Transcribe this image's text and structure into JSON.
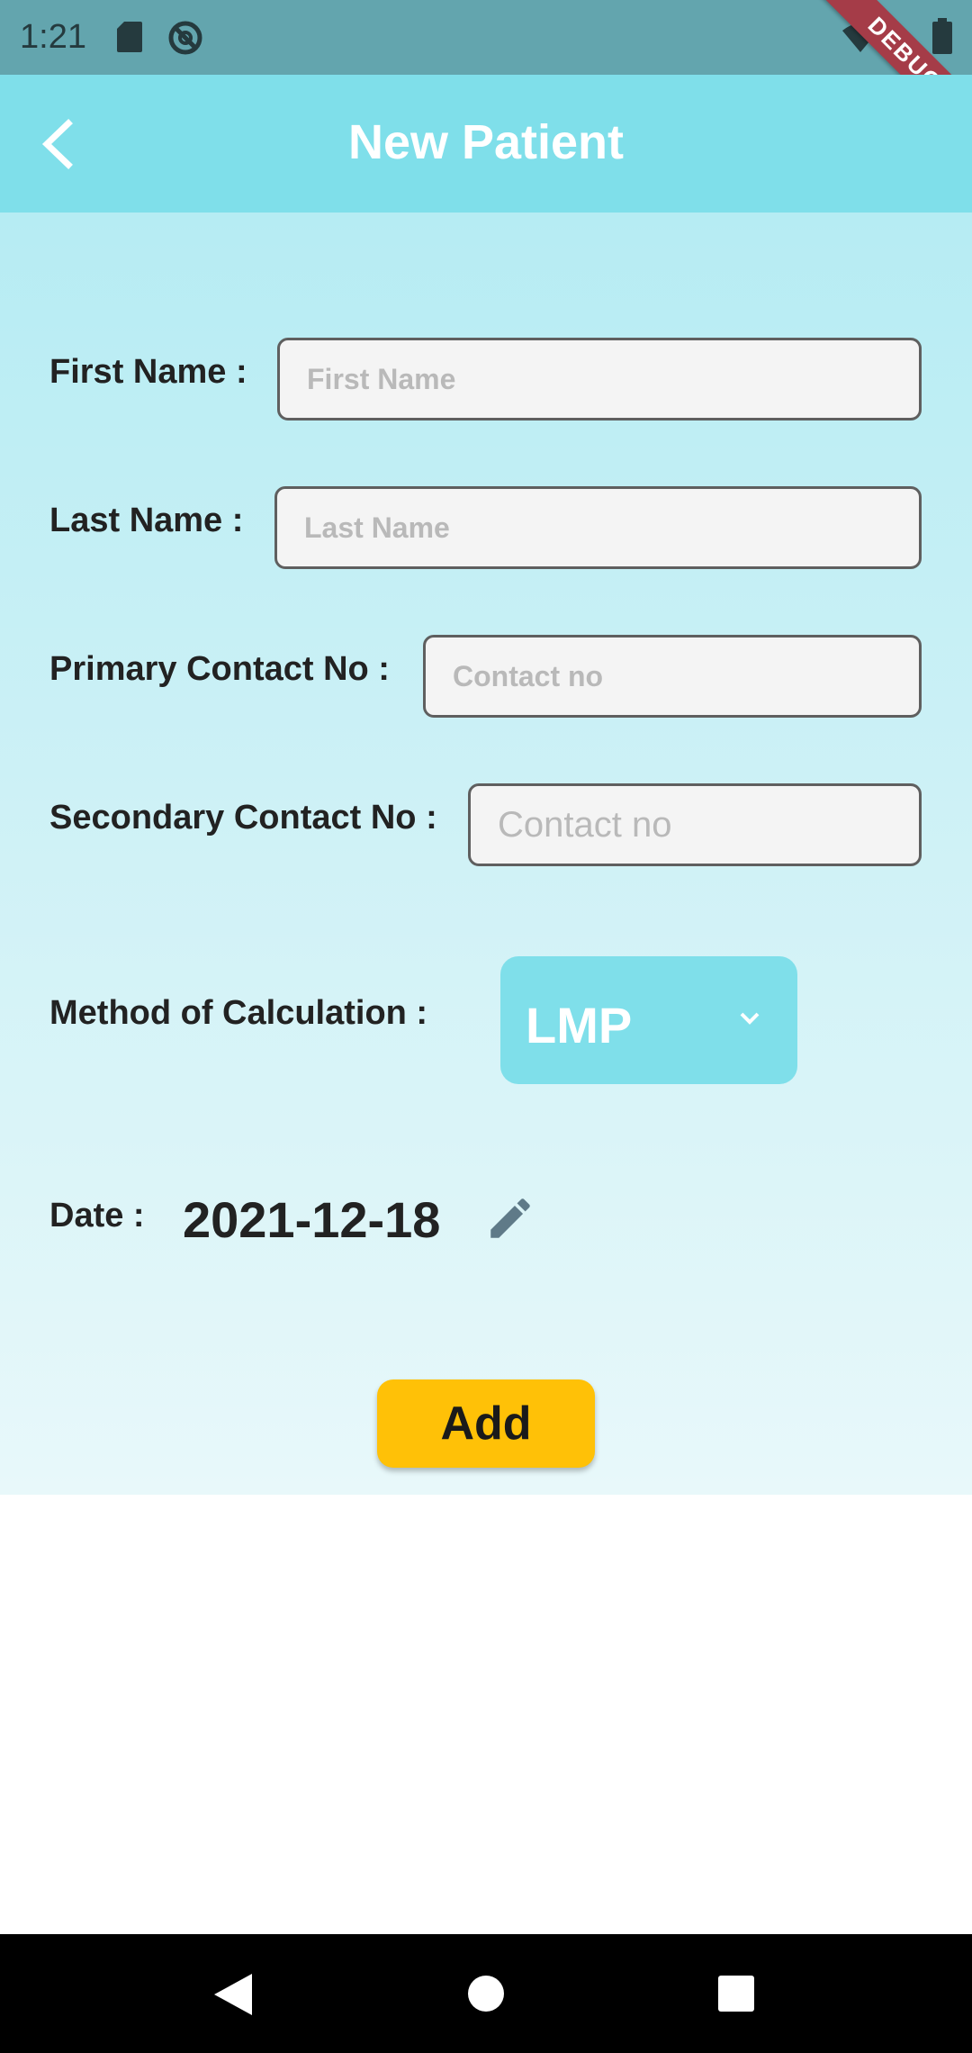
{
  "status_bar": {
    "time": "1:21",
    "debug_banner": "DEBUG"
  },
  "app_bar": {
    "title": "New Patient",
    "back_icon": "chevron-left-icon"
  },
  "form": {
    "first_name": {
      "label": "First Name :",
      "placeholder": "First Name",
      "value": ""
    },
    "last_name": {
      "label": "Last Name :",
      "placeholder": "Last Name",
      "value": ""
    },
    "primary_contact": {
      "label": "Primary Contact No :",
      "placeholder": "Contact no",
      "value": ""
    },
    "secondary_contact": {
      "label": "Secondary Contact No :",
      "placeholder": "Contact no",
      "value": ""
    },
    "method": {
      "label": "Method of Calculation :",
      "selected": "LMP"
    },
    "date": {
      "label": "Date :",
      "value": "2021-12-18"
    },
    "add_button": "Add"
  },
  "colors": {
    "status_bar": "#63a5ae",
    "app_bar": "#7fdfea",
    "accent_button": "#ffc107",
    "debug_ribbon": "#a53c48"
  }
}
